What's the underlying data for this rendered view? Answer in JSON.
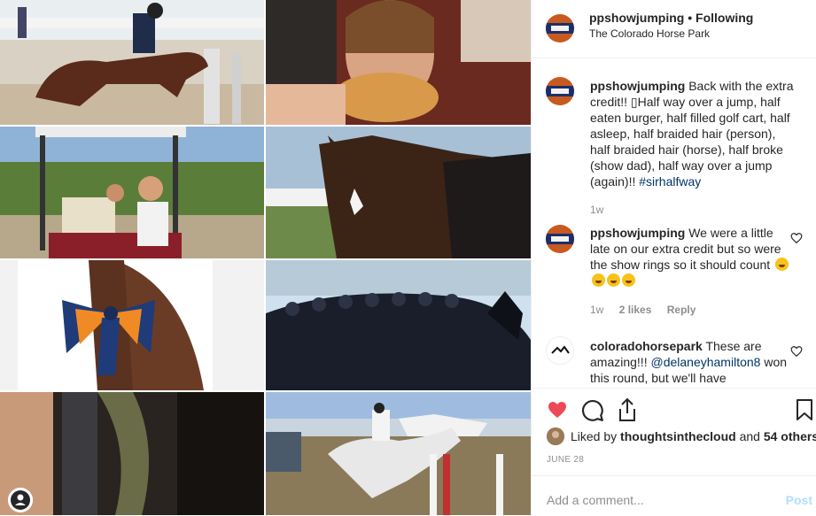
{
  "header": {
    "username": "ppshowjumping",
    "separator": "•",
    "follow_status": "Following",
    "location": "The Colorado Horse Park"
  },
  "caption": {
    "username": "ppshowjumping",
    "text": "Back with the extra credit!! ▯Half way over a jump, half eaten burger, half filled golf cart, half asleep, half braided hair (person), half braided hair (horse), half broke (show dad), half way over a jump (again)!! ",
    "hashtag": "#sirhalfway",
    "time": "1w"
  },
  "comments": [
    {
      "username": "ppshowjumping",
      "text": "We were a little late on our extra credit but so were the show rings so it should count",
      "time": "1w",
      "likes": "2 likes",
      "reply": "Reply"
    },
    {
      "username": "coloradohorsepark",
      "text": "These are amazing!!! ",
      "mention": "@delaneyhamilton8",
      "text2": " won this round, but we'll have"
    }
  ],
  "likes": {
    "prefix": "Liked by ",
    "user": "thoughtsinthecloud",
    "middle": " and ",
    "others": "54 others"
  },
  "date": "JUNE 28",
  "add_comment": {
    "placeholder": "Add a comment...",
    "post_label": "Post"
  },
  "colors": {
    "like_red": "#ed4956",
    "link_blue": "#003569",
    "post_disabled": "#b2dffc",
    "muted": "#8e8e8e"
  },
  "icons": [
    "heart-icon",
    "comment-icon",
    "share-icon",
    "bookmark-icon"
  ]
}
